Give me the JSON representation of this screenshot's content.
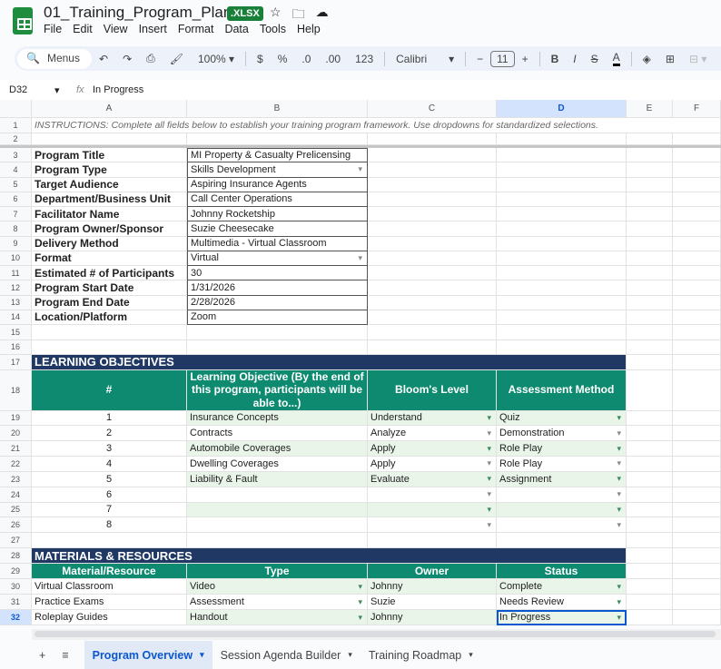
{
  "app": {
    "title": "01_Training_Program_Planner",
    "badge": ".XLSX",
    "menu": [
      "File",
      "Edit",
      "View",
      "Insert",
      "Format",
      "Data",
      "Tools",
      "Help"
    ]
  },
  "toolbar": {
    "search": "Menus",
    "zoom": "100%",
    "currency": "$",
    "percent": "%",
    "dec_less": ".0",
    "dec_more": ".00",
    "number_format": "123",
    "font": "Calibri",
    "font_size": "11",
    "bold": "B",
    "italic": "I",
    "strike": "S",
    "text_color": "A"
  },
  "formula_bar": {
    "cell_ref": "D32",
    "fx": "fx",
    "value": "In Progress"
  },
  "columns": [
    "A",
    "B",
    "C",
    "D",
    "E",
    "F"
  ],
  "instructions": "INSTRUCTIONS: Complete all fields below to establish your training program framework. Use dropdowns for standardized selections.",
  "program_fields": [
    {
      "label": "Program Title",
      "value": "MI Property  & Casualty Prelicensing",
      "dropdown": false
    },
    {
      "label": "Program Type",
      "value": "Skills Development",
      "dropdown": true
    },
    {
      "label": "Target Audience",
      "value": "Aspiring Insurance Agents",
      "dropdown": false
    },
    {
      "label": "Department/Business Unit",
      "value": "Call Center Operations",
      "dropdown": false
    },
    {
      "label": "Facilitator Name",
      "value": "Johnny Rocketship",
      "dropdown": false
    },
    {
      "label": "Program Owner/Sponsor",
      "value": "Suzie Cheesecake",
      "dropdown": false
    },
    {
      "label": "Delivery Method",
      "value": "Multimedia - Virtual Classroom",
      "dropdown": false
    },
    {
      "label": "Format",
      "value": "Virtual",
      "dropdown": true
    },
    {
      "label": "Estimated # of Participants",
      "value": "30",
      "dropdown": false
    },
    {
      "label": "Program Start Date",
      "value": "1/31/2026",
      "dropdown": false
    },
    {
      "label": "Program End Date",
      "value": "2/28/2026",
      "dropdown": false
    },
    {
      "label": "Location/Platform",
      "value": "Zoom",
      "dropdown": false
    }
  ],
  "objectives": {
    "title": "LEARNING OBJECTIVES",
    "headers": [
      "#",
      "Learning Objective (By the end of this program, participants will be able to...)",
      "Bloom's Level",
      "Assessment Method"
    ],
    "rows": [
      [
        "1",
        "Insurance Concepts",
        "Understand",
        "Quiz"
      ],
      [
        "2",
        "Contracts",
        "Analyze",
        "Demonstration"
      ],
      [
        "3",
        "Automobile Coverages",
        "Apply",
        "Role Play"
      ],
      [
        "4",
        "Dwelling Coverages",
        "Apply",
        "Role Play"
      ],
      [
        "5",
        "Liability & Fault",
        "Evaluate",
        "Assignment"
      ],
      [
        "6",
        "",
        "",
        ""
      ],
      [
        "7",
        "",
        "",
        ""
      ],
      [
        "8",
        "",
        "",
        ""
      ]
    ]
  },
  "materials": {
    "title": "MATERIALS & RESOURCES",
    "headers": [
      "Material/Resource",
      "Type",
      "Owner",
      "Status"
    ],
    "rows": [
      [
        "Virtual Classroom",
        "Video",
        "Johnny",
        "Complete"
      ],
      [
        "Practice Exams",
        "Assessment",
        "Suzie",
        "Needs Review"
      ],
      [
        "Roleplay Guides",
        "Handout",
        "Johnny",
        "In Progress"
      ]
    ]
  },
  "sheets": [
    {
      "label": "Program Overview",
      "active": true
    },
    {
      "label": "Session Agenda Builder",
      "active": false
    },
    {
      "label": "Training Roadmap",
      "active": false
    }
  ],
  "colors": {
    "navy": "#1f3864",
    "teal": "#0e8a70",
    "light_green": "#e9f5e9",
    "selection": "#0b57d0"
  }
}
